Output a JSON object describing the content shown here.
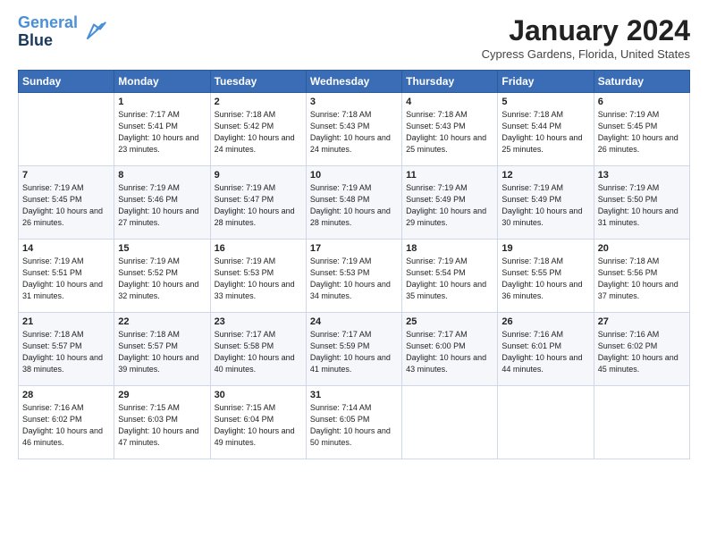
{
  "logo": {
    "line1": "General",
    "line2": "Blue"
  },
  "title": "January 2024",
  "subtitle": "Cypress Gardens, Florida, United States",
  "days_of_week": [
    "Sunday",
    "Monday",
    "Tuesday",
    "Wednesday",
    "Thursday",
    "Friday",
    "Saturday"
  ],
  "weeks": [
    [
      {
        "num": "",
        "sunrise": "",
        "sunset": "",
        "daylight": ""
      },
      {
        "num": "1",
        "sunrise": "Sunrise: 7:17 AM",
        "sunset": "Sunset: 5:41 PM",
        "daylight": "Daylight: 10 hours and 23 minutes."
      },
      {
        "num": "2",
        "sunrise": "Sunrise: 7:18 AM",
        "sunset": "Sunset: 5:42 PM",
        "daylight": "Daylight: 10 hours and 24 minutes."
      },
      {
        "num": "3",
        "sunrise": "Sunrise: 7:18 AM",
        "sunset": "Sunset: 5:43 PM",
        "daylight": "Daylight: 10 hours and 24 minutes."
      },
      {
        "num": "4",
        "sunrise": "Sunrise: 7:18 AM",
        "sunset": "Sunset: 5:43 PM",
        "daylight": "Daylight: 10 hours and 25 minutes."
      },
      {
        "num": "5",
        "sunrise": "Sunrise: 7:18 AM",
        "sunset": "Sunset: 5:44 PM",
        "daylight": "Daylight: 10 hours and 25 minutes."
      },
      {
        "num": "6",
        "sunrise": "Sunrise: 7:19 AM",
        "sunset": "Sunset: 5:45 PM",
        "daylight": "Daylight: 10 hours and 26 minutes."
      }
    ],
    [
      {
        "num": "7",
        "sunrise": "Sunrise: 7:19 AM",
        "sunset": "Sunset: 5:45 PM",
        "daylight": "Daylight: 10 hours and 26 minutes."
      },
      {
        "num": "8",
        "sunrise": "Sunrise: 7:19 AM",
        "sunset": "Sunset: 5:46 PM",
        "daylight": "Daylight: 10 hours and 27 minutes."
      },
      {
        "num": "9",
        "sunrise": "Sunrise: 7:19 AM",
        "sunset": "Sunset: 5:47 PM",
        "daylight": "Daylight: 10 hours and 28 minutes."
      },
      {
        "num": "10",
        "sunrise": "Sunrise: 7:19 AM",
        "sunset": "Sunset: 5:48 PM",
        "daylight": "Daylight: 10 hours and 28 minutes."
      },
      {
        "num": "11",
        "sunrise": "Sunrise: 7:19 AM",
        "sunset": "Sunset: 5:49 PM",
        "daylight": "Daylight: 10 hours and 29 minutes."
      },
      {
        "num": "12",
        "sunrise": "Sunrise: 7:19 AM",
        "sunset": "Sunset: 5:49 PM",
        "daylight": "Daylight: 10 hours and 30 minutes."
      },
      {
        "num": "13",
        "sunrise": "Sunrise: 7:19 AM",
        "sunset": "Sunset: 5:50 PM",
        "daylight": "Daylight: 10 hours and 31 minutes."
      }
    ],
    [
      {
        "num": "14",
        "sunrise": "Sunrise: 7:19 AM",
        "sunset": "Sunset: 5:51 PM",
        "daylight": "Daylight: 10 hours and 31 minutes."
      },
      {
        "num": "15",
        "sunrise": "Sunrise: 7:19 AM",
        "sunset": "Sunset: 5:52 PM",
        "daylight": "Daylight: 10 hours and 32 minutes."
      },
      {
        "num": "16",
        "sunrise": "Sunrise: 7:19 AM",
        "sunset": "Sunset: 5:53 PM",
        "daylight": "Daylight: 10 hours and 33 minutes."
      },
      {
        "num": "17",
        "sunrise": "Sunrise: 7:19 AM",
        "sunset": "Sunset: 5:53 PM",
        "daylight": "Daylight: 10 hours and 34 minutes."
      },
      {
        "num": "18",
        "sunrise": "Sunrise: 7:19 AM",
        "sunset": "Sunset: 5:54 PM",
        "daylight": "Daylight: 10 hours and 35 minutes."
      },
      {
        "num": "19",
        "sunrise": "Sunrise: 7:18 AM",
        "sunset": "Sunset: 5:55 PM",
        "daylight": "Daylight: 10 hours and 36 minutes."
      },
      {
        "num": "20",
        "sunrise": "Sunrise: 7:18 AM",
        "sunset": "Sunset: 5:56 PM",
        "daylight": "Daylight: 10 hours and 37 minutes."
      }
    ],
    [
      {
        "num": "21",
        "sunrise": "Sunrise: 7:18 AM",
        "sunset": "Sunset: 5:57 PM",
        "daylight": "Daylight: 10 hours and 38 minutes."
      },
      {
        "num": "22",
        "sunrise": "Sunrise: 7:18 AM",
        "sunset": "Sunset: 5:57 PM",
        "daylight": "Daylight: 10 hours and 39 minutes."
      },
      {
        "num": "23",
        "sunrise": "Sunrise: 7:17 AM",
        "sunset": "Sunset: 5:58 PM",
        "daylight": "Daylight: 10 hours and 40 minutes."
      },
      {
        "num": "24",
        "sunrise": "Sunrise: 7:17 AM",
        "sunset": "Sunset: 5:59 PM",
        "daylight": "Daylight: 10 hours and 41 minutes."
      },
      {
        "num": "25",
        "sunrise": "Sunrise: 7:17 AM",
        "sunset": "Sunset: 6:00 PM",
        "daylight": "Daylight: 10 hours and 43 minutes."
      },
      {
        "num": "26",
        "sunrise": "Sunrise: 7:16 AM",
        "sunset": "Sunset: 6:01 PM",
        "daylight": "Daylight: 10 hours and 44 minutes."
      },
      {
        "num": "27",
        "sunrise": "Sunrise: 7:16 AM",
        "sunset": "Sunset: 6:02 PM",
        "daylight": "Daylight: 10 hours and 45 minutes."
      }
    ],
    [
      {
        "num": "28",
        "sunrise": "Sunrise: 7:16 AM",
        "sunset": "Sunset: 6:02 PM",
        "daylight": "Daylight: 10 hours and 46 minutes."
      },
      {
        "num": "29",
        "sunrise": "Sunrise: 7:15 AM",
        "sunset": "Sunset: 6:03 PM",
        "daylight": "Daylight: 10 hours and 47 minutes."
      },
      {
        "num": "30",
        "sunrise": "Sunrise: 7:15 AM",
        "sunset": "Sunset: 6:04 PM",
        "daylight": "Daylight: 10 hours and 49 minutes."
      },
      {
        "num": "31",
        "sunrise": "Sunrise: 7:14 AM",
        "sunset": "Sunset: 6:05 PM",
        "daylight": "Daylight: 10 hours and 50 minutes."
      },
      {
        "num": "",
        "sunrise": "",
        "sunset": "",
        "daylight": ""
      },
      {
        "num": "",
        "sunrise": "",
        "sunset": "",
        "daylight": ""
      },
      {
        "num": "",
        "sunrise": "",
        "sunset": "",
        "daylight": ""
      }
    ]
  ]
}
